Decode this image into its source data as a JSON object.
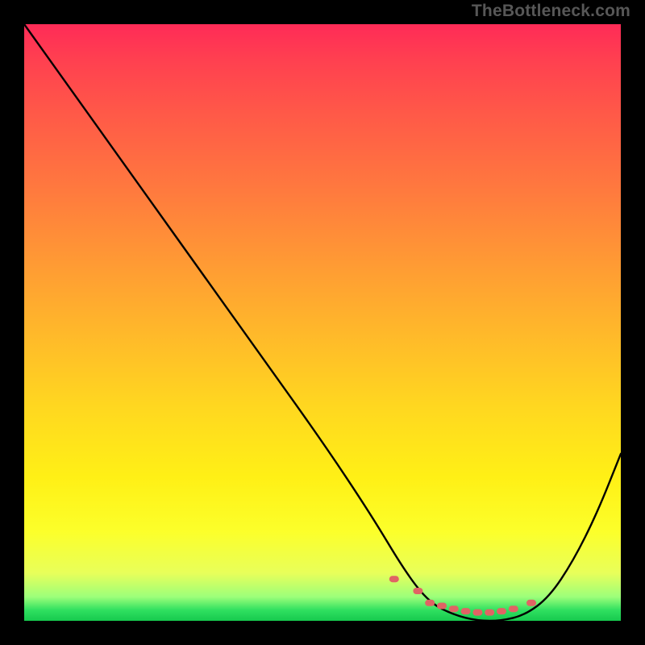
{
  "attribution": "TheBottleneck.com",
  "chart_data": {
    "type": "line",
    "title": "",
    "xlabel": "",
    "ylabel": "",
    "xlim": [
      0,
      100
    ],
    "ylim": [
      0,
      100
    ],
    "series": [
      {
        "name": "bottleneck-curve",
        "x": [
          0,
          10,
          20,
          30,
          40,
          50,
          58,
          64,
          68,
          72,
          76,
          80,
          84,
          88,
          92,
          96,
          100
        ],
        "values": [
          100,
          86,
          72,
          58,
          44,
          30,
          18,
          8,
          3,
          1,
          0,
          0,
          1,
          4,
          10,
          18,
          28
        ]
      }
    ],
    "highlight": {
      "name": "optimal-range-dots",
      "x": [
        62,
        66,
        68,
        70,
        72,
        74,
        76,
        78,
        80,
        82,
        85
      ],
      "values": [
        7,
        5,
        3,
        2.5,
        2,
        1.6,
        1.4,
        1.4,
        1.6,
        2,
        3
      ]
    },
    "background_gradient": {
      "top": "#ff2b57",
      "middle": "#ffd720",
      "bottom": "#16c94e"
    }
  }
}
